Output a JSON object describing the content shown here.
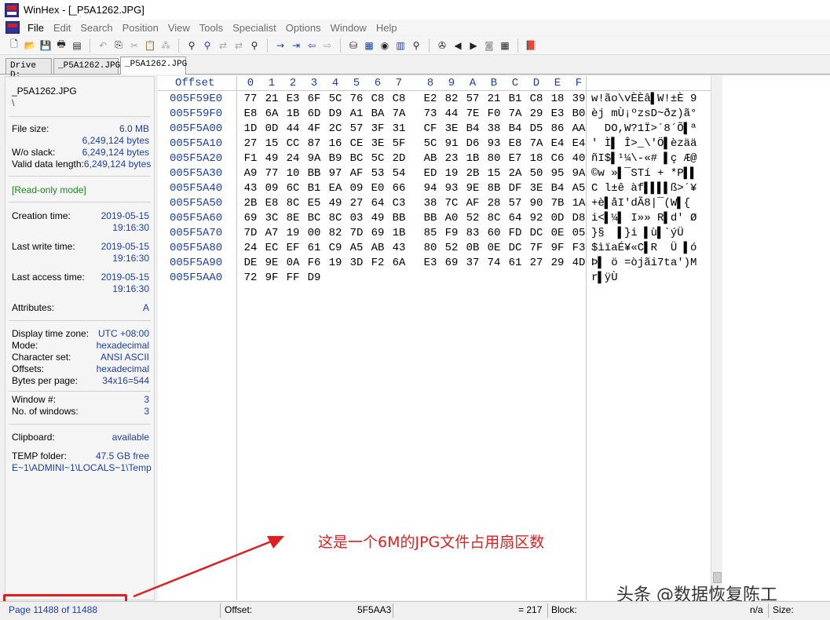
{
  "window": {
    "title": "WinHex - [_P5A1262.JPG]"
  },
  "menu": [
    "File",
    "Edit",
    "Search",
    "Position",
    "View",
    "Tools",
    "Specialist",
    "Options",
    "Window",
    "Help"
  ],
  "toolbar": {
    "icons": [
      "new-file-icon",
      "open-folder-icon",
      "save-icon",
      "print-icon",
      "properties-icon",
      "undo-icon",
      "copy-icon",
      "cut-icon",
      "paste-icon",
      "binary-icon",
      "find-text-icon",
      "find-hex-icon",
      "replace-text-icon",
      "replace-hex-icon",
      "find-next-icon",
      "goto-offset-icon",
      "goto-sector-icon",
      "back-icon",
      "forward-icon",
      "disk-edit-icon",
      "ram-edit-icon",
      "disk-icon",
      "calculator-icon",
      "search-icon",
      "tools-icon",
      "prev-icon",
      "next-icon",
      "camera-icon",
      "table-icon",
      "help-book-icon"
    ]
  },
  "tabs": [
    "Drive D:",
    "_P5A1262.JPG",
    "_P5A1262.JPG"
  ],
  "sidebar": {
    "filename": "_P5A1262.JPG",
    "path": "\\",
    "file_size_label": "File size:",
    "file_size_mb": "6.0 MB",
    "file_size_bytes": "6,249,124 bytes",
    "wo_slack_label": "W/o slack:",
    "wo_slack_value": "6,249,124 bytes",
    "valid_label": "Valid data length:",
    "valid_value": "6,249,124 bytes",
    "mode_note": "[Read-only mode]",
    "creation_label": "Creation time:",
    "creation_date": "2019-05-15",
    "creation_time": "19:16:30",
    "last_write_label": "Last write time:",
    "last_write_date": "2019-05-15",
    "last_write_time": "19:16:30",
    "last_access_label": "Last access time:",
    "last_access_date": "2019-05-15",
    "last_access_time": "19:16:30",
    "attributes_label": "Attributes:",
    "attributes_value": "A",
    "tz_label": "Display time zone:",
    "tz_value": "UTC +08:00",
    "mode_label": "Mode:",
    "mode_value": "hexadecimal",
    "charset_label": "Character set:",
    "charset_value": "ANSI ASCII",
    "offsets_label": "Offsets:",
    "offsets_value": "hexadecimal",
    "bpp_label": "Bytes per page:",
    "bpp_value": "34x16=544",
    "window_num_label": "Window #:",
    "window_num_value": "3",
    "num_windows_label": "No. of windows:",
    "num_windows_value": "3",
    "clipboard_label": "Clipboard:",
    "clipboard_value": "available",
    "temp_label": "TEMP folder:",
    "temp_value": "47.5 GB free",
    "temp_path": "E~1\\ADMINI~1\\LOCALS~1\\Temp"
  },
  "hex": {
    "offset_header": "Offset",
    "columns": [
      "0",
      "1",
      "2",
      "3",
      "4",
      "5",
      "6",
      "7",
      "8",
      "9",
      "A",
      "B",
      "C",
      "D",
      "E",
      "F"
    ],
    "rows": [
      {
        "offset": "005F59E0",
        "bytes": [
          "77",
          "21",
          "E3",
          "6F",
          "5C",
          "76",
          "C8",
          "C8",
          "E2",
          "82",
          "57",
          "21",
          "B1",
          "C8",
          "18",
          "39"
        ],
        "text": "w!ão\\vÈÈâ▌W!±È 9"
      },
      {
        "offset": "005F59F0",
        "bytes": [
          "E8",
          "6A",
          "1B",
          "6D",
          "D9",
          "A1",
          "BA",
          "7A",
          "73",
          "44",
          "7E",
          "F0",
          "7A",
          "29",
          "E3",
          "B0"
        ],
        "text": "èj mÙ¡ºzsD~ðz)ã°"
      },
      {
        "offset": "005F5A00",
        "bytes": [
          "1D",
          "0D",
          "44",
          "4F",
          "2C",
          "57",
          "3F",
          "31",
          "CF",
          "3E",
          "B4",
          "38",
          "B4",
          "D5",
          "86",
          "AA"
        ],
        "text": "  DO,W?1Ï>´8´Õ▌ª"
      },
      {
        "offset": "005F5A10",
        "bytes": [
          "27",
          "15",
          "CC",
          "87",
          "16",
          "CE",
          "3E",
          "5F",
          "5C",
          "91",
          "D6",
          "93",
          "E8",
          "7A",
          "E4",
          "E4"
        ],
        "text": "' Ì▌ Î>_\\'Ö▌èzää"
      },
      {
        "offset": "005F5A20",
        "bytes": [
          "F1",
          "49",
          "24",
          "9A",
          "B9",
          "BC",
          "5C",
          "2D",
          "AB",
          "23",
          "1B",
          "80",
          "E7",
          "18",
          "C6",
          "40"
        ],
        "text": "ñI$▌¹¼\\-«# ▌ç Æ@"
      },
      {
        "offset": "005F5A30",
        "bytes": [
          "A9",
          "77",
          "10",
          "BB",
          "97",
          "AF",
          "53",
          "54",
          "ED",
          "19",
          "2B",
          "15",
          "2A",
          "50",
          "95",
          "9A"
        ],
        "text": "©w »▌¯STí + *P▌▌"
      },
      {
        "offset": "005F5A40",
        "bytes": [
          "43",
          "09",
          "6C",
          "B1",
          "EA",
          "09",
          "E0",
          "66",
          "94",
          "93",
          "9E",
          "8B",
          "DF",
          "3E",
          "B4",
          "A5"
        ],
        "text": "C l±ê àf▌▌▌▌ß>´¥"
      },
      {
        "offset": "005F5A50",
        "bytes": [
          "2B",
          "E8",
          "8C",
          "E5",
          "49",
          "27",
          "64",
          "C3",
          "38",
          "7C",
          "AF",
          "28",
          "57",
          "90",
          "7B",
          "1A"
        ],
        "text": "+è▌åI'dÃ8|¯(W▌{ "
      },
      {
        "offset": "005F5A60",
        "bytes": [
          "69",
          "3C",
          "8E",
          "BC",
          "8C",
          "03",
          "49",
          "BB",
          "BB",
          "A0",
          "52",
          "8C",
          "64",
          "92",
          "0D",
          "D8"
        ],
        "text": "i<▌¼▌ I»» R▌d' Ø"
      },
      {
        "offset": "005F5A70",
        "bytes": [
          "7D",
          "A7",
          "19",
          "00",
          "82",
          "7D",
          "69",
          "1B",
          "85",
          "F9",
          "83",
          "60",
          "FD",
          "DC",
          "0E",
          "05"
        ],
        "text": "}§  ▌}i ▌ù▌`ýÜ  "
      },
      {
        "offset": "005F5A80",
        "bytes": [
          "24",
          "EC",
          "EF",
          "61",
          "C9",
          "A5",
          "AB",
          "43",
          "80",
          "52",
          "0B",
          "0E",
          "DC",
          "7F",
          "9F",
          "F3"
        ],
        "text": "$ìïaÉ¥«C▌R  Ü ▌ó"
      },
      {
        "offset": "005F5A90",
        "bytes": [
          "DE",
          "9E",
          "0A",
          "F6",
          "19",
          "3D",
          "F2",
          "6A",
          "E3",
          "69",
          "37",
          "74",
          "61",
          "27",
          "29",
          "4D"
        ],
        "text": "Þ▌ ö =òjãi7ta')M"
      },
      {
        "offset": "005F5AA0",
        "bytes": [
          "72",
          "9F",
          "FF",
          "D9"
        ],
        "text": "r▌ÿÙ"
      }
    ]
  },
  "annotation": {
    "text": "这是一个6M的JPG文件占用扇区数",
    "color": "#e02020"
  },
  "watermark": "头条 @数据恢复陈工",
  "status": {
    "page": "Page 11488 of 11488",
    "offset_label": "Offset:",
    "offset_value": "5F5AA3",
    "eq_value": "= 217",
    "block_label": "Block:",
    "block_value": "n/a",
    "size_label": "Size:"
  }
}
